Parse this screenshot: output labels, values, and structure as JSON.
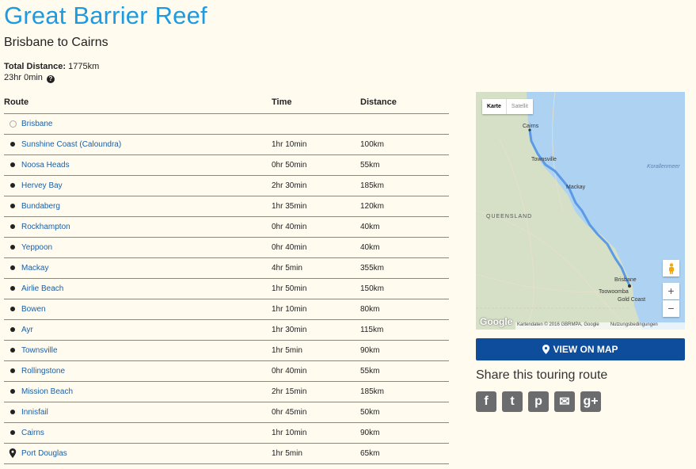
{
  "header": {
    "title": "Great Barrier Reef",
    "subtitle": "Brisbane to Cairns",
    "total_distance_label": "Total Distance:",
    "total_distance_value": "1775km",
    "total_time": "23hr 0min",
    "help_icon": "question-circle-icon"
  },
  "table": {
    "headers": {
      "route": "Route",
      "time": "Time",
      "distance": "Distance"
    },
    "rows": [
      {
        "stop": "Brisbane",
        "time": "",
        "distance": "",
        "marker": "ring"
      },
      {
        "stop": "Sunshine Coast (Caloundra)",
        "time": "1hr 10min",
        "distance": "100km",
        "marker": "dot"
      },
      {
        "stop": "Noosa Heads",
        "time": "0hr 50min",
        "distance": "55km",
        "marker": "dot"
      },
      {
        "stop": "Hervey Bay",
        "time": "2hr 30min",
        "distance": "185km",
        "marker": "dot"
      },
      {
        "stop": "Bundaberg",
        "time": "1hr 35min",
        "distance": "120km",
        "marker": "dot"
      },
      {
        "stop": "Rockhampton",
        "time": "0hr 40min",
        "distance": "40km",
        "marker": "dot"
      },
      {
        "stop": "Yeppoon",
        "time": "0hr 40min",
        "distance": "40km",
        "marker": "dot"
      },
      {
        "stop": "Mackay",
        "time": "4hr 5min",
        "distance": "355km",
        "marker": "dot"
      },
      {
        "stop": "Airlie Beach",
        "time": "1hr 50min",
        "distance": "150km",
        "marker": "dot"
      },
      {
        "stop": "Bowen",
        "time": "1hr 10min",
        "distance": "80km",
        "marker": "dot"
      },
      {
        "stop": "Ayr",
        "time": "1hr 30min",
        "distance": "115km",
        "marker": "dot"
      },
      {
        "stop": "Townsville",
        "time": "1hr 5min",
        "distance": "90km",
        "marker": "dot"
      },
      {
        "stop": "Rollingstone",
        "time": "0hr 40min",
        "distance": "55km",
        "marker": "dot"
      },
      {
        "stop": "Mission Beach",
        "time": "2hr 15min",
        "distance": "185km",
        "marker": "dot"
      },
      {
        "stop": "Innisfail",
        "time": "0hr 45min",
        "distance": "50km",
        "marker": "dot"
      },
      {
        "stop": "Cairns",
        "time": "1hr 10min",
        "distance": "90km",
        "marker": "dot"
      },
      {
        "stop": "Port Douglas",
        "time": "1hr 5min",
        "distance": "65km",
        "marker": "pin"
      }
    ]
  },
  "map": {
    "tab_map": "Karte",
    "tab_satellite": "Satellit",
    "labels": {
      "cairns": "Cairns",
      "townsville": "Townsville",
      "mackay": "Mackay",
      "queensland": "QUEENSLAND",
      "coral_sea": "Korallenmeer",
      "brisbane": "Brisbane",
      "toowoomba": "Toowoomba",
      "gold_coast": "Gold Coast"
    },
    "zoom_in": "+",
    "zoom_out": "−",
    "google": "Google",
    "attribution": "Kartendaten © 2016 GBRMPA, Google",
    "terms": "Nutzungsbedingungen",
    "route_color": "#5b9be6",
    "sea_color": "#aed3f2"
  },
  "actions": {
    "view_on_map": "VIEW ON MAP",
    "share_title": "Share this touring route",
    "share": [
      {
        "name": "facebook-icon",
        "glyph": "f"
      },
      {
        "name": "twitter-icon",
        "glyph": "t"
      },
      {
        "name": "pinterest-icon",
        "glyph": "p"
      },
      {
        "name": "email-icon",
        "glyph": "✉"
      },
      {
        "name": "googleplus-icon",
        "glyph": "g+"
      }
    ]
  }
}
